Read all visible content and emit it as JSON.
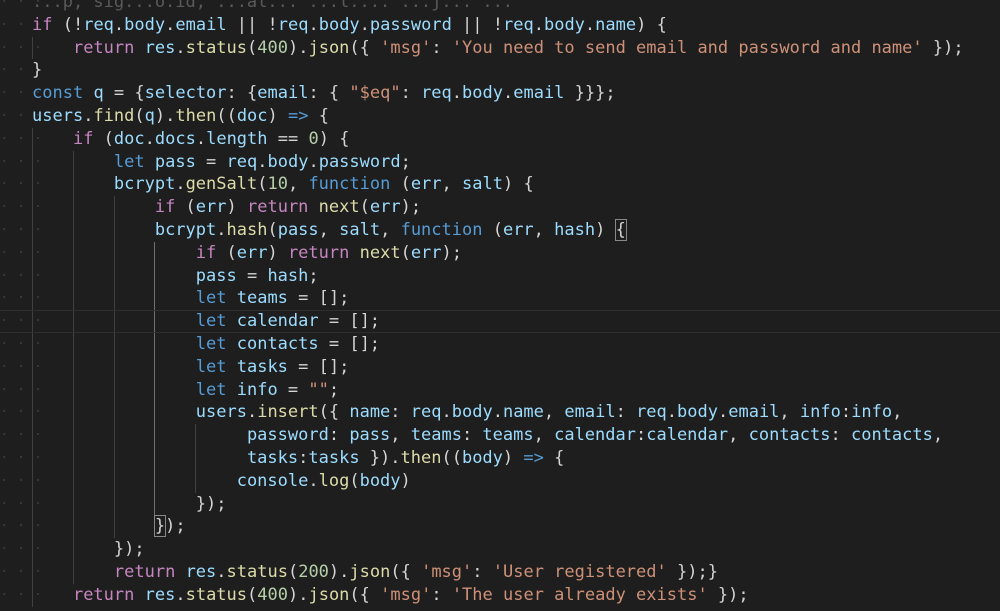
{
  "editor": {
    "indent_columns": 4,
    "lines": [
      {
        "indent": 0,
        "tokens": [
          {
            "t": "...p, sig...o.id, ...al... ...l.... ...j... ...",
            "c": "dim"
          }
        ]
      },
      {
        "indent": 0,
        "tokens": [
          {
            "t": "if",
            "c": "ctl"
          },
          {
            "t": " (!",
            "c": "pun"
          },
          {
            "t": "req",
            "c": "var"
          },
          {
            "t": ".",
            "c": "pun"
          },
          {
            "t": "body",
            "c": "var"
          },
          {
            "t": ".",
            "c": "pun"
          },
          {
            "t": "email",
            "c": "var"
          },
          {
            "t": " || !",
            "c": "pun"
          },
          {
            "t": "req",
            "c": "var"
          },
          {
            "t": ".",
            "c": "pun"
          },
          {
            "t": "body",
            "c": "var"
          },
          {
            "t": ".",
            "c": "pun"
          },
          {
            "t": "password",
            "c": "var"
          },
          {
            "t": " || !",
            "c": "pun"
          },
          {
            "t": "req",
            "c": "var"
          },
          {
            "t": ".",
            "c": "pun"
          },
          {
            "t": "body",
            "c": "var"
          },
          {
            "t": ".",
            "c": "pun"
          },
          {
            "t": "name",
            "c": "var"
          },
          {
            "t": ") {",
            "c": "pun"
          }
        ]
      },
      {
        "indent": 4,
        "tokens": [
          {
            "t": "return",
            "c": "ctl"
          },
          {
            "t": " ",
            "c": "pun"
          },
          {
            "t": "res",
            "c": "var"
          },
          {
            "t": ".",
            "c": "pun"
          },
          {
            "t": "status",
            "c": "fn"
          },
          {
            "t": "(",
            "c": "pun"
          },
          {
            "t": "400",
            "c": "num"
          },
          {
            "t": ").",
            "c": "pun"
          },
          {
            "t": "json",
            "c": "fn"
          },
          {
            "t": "({ ",
            "c": "pun"
          },
          {
            "t": "'msg'",
            "c": "str"
          },
          {
            "t": ": ",
            "c": "pun"
          },
          {
            "t": "'You need to send email and password and name'",
            "c": "str"
          },
          {
            "t": " });",
            "c": "pun"
          }
        ]
      },
      {
        "indent": 0,
        "tokens": [
          {
            "t": "}",
            "c": "pun"
          }
        ]
      },
      {
        "indent": 0,
        "tokens": [
          {
            "t": "const",
            "c": "kw"
          },
          {
            "t": " ",
            "c": "pun"
          },
          {
            "t": "q",
            "c": "var"
          },
          {
            "t": " = {",
            "c": "pun"
          },
          {
            "t": "selector",
            "c": "var"
          },
          {
            "t": ": {",
            "c": "pun"
          },
          {
            "t": "email",
            "c": "var"
          },
          {
            "t": ": { ",
            "c": "pun"
          },
          {
            "t": "\"$eq\"",
            "c": "str"
          },
          {
            "t": ": ",
            "c": "pun"
          },
          {
            "t": "req",
            "c": "var"
          },
          {
            "t": ".",
            "c": "pun"
          },
          {
            "t": "body",
            "c": "var"
          },
          {
            "t": ".",
            "c": "pun"
          },
          {
            "t": "email",
            "c": "var"
          },
          {
            "t": " }}};",
            "c": "pun"
          }
        ]
      },
      {
        "indent": 0,
        "tokens": [
          {
            "t": "users",
            "c": "var"
          },
          {
            "t": ".",
            "c": "pun"
          },
          {
            "t": "find",
            "c": "fn"
          },
          {
            "t": "(",
            "c": "pun"
          },
          {
            "t": "q",
            "c": "var"
          },
          {
            "t": ").",
            "c": "pun"
          },
          {
            "t": "then",
            "c": "fn"
          },
          {
            "t": "((",
            "c": "pun"
          },
          {
            "t": "doc",
            "c": "var"
          },
          {
            "t": ") ",
            "c": "pun"
          },
          {
            "t": "=>",
            "c": "kw"
          },
          {
            "t": " {",
            "c": "pun"
          }
        ]
      },
      {
        "indent": 4,
        "tokens": [
          {
            "t": "if",
            "c": "ctl"
          },
          {
            "t": " (",
            "c": "pun"
          },
          {
            "t": "doc",
            "c": "var"
          },
          {
            "t": ".",
            "c": "pun"
          },
          {
            "t": "docs",
            "c": "var"
          },
          {
            "t": ".",
            "c": "pun"
          },
          {
            "t": "length",
            "c": "var"
          },
          {
            "t": " == ",
            "c": "pun"
          },
          {
            "t": "0",
            "c": "num"
          },
          {
            "t": ") {",
            "c": "pun"
          }
        ]
      },
      {
        "indent": 8,
        "tokens": [
          {
            "t": "let",
            "c": "kw"
          },
          {
            "t": " ",
            "c": "pun"
          },
          {
            "t": "pass",
            "c": "var"
          },
          {
            "t": " = ",
            "c": "pun"
          },
          {
            "t": "req",
            "c": "var"
          },
          {
            "t": ".",
            "c": "pun"
          },
          {
            "t": "body",
            "c": "var"
          },
          {
            "t": ".",
            "c": "pun"
          },
          {
            "t": "password",
            "c": "var"
          },
          {
            "t": ";",
            "c": "pun"
          }
        ]
      },
      {
        "indent": 8,
        "tokens": [
          {
            "t": "bcrypt",
            "c": "var"
          },
          {
            "t": ".",
            "c": "pun"
          },
          {
            "t": "genSalt",
            "c": "fn"
          },
          {
            "t": "(",
            "c": "pun"
          },
          {
            "t": "10",
            "c": "num"
          },
          {
            "t": ", ",
            "c": "pun"
          },
          {
            "t": "function",
            "c": "kw"
          },
          {
            "t": " (",
            "c": "pun"
          },
          {
            "t": "err",
            "c": "var"
          },
          {
            "t": ", ",
            "c": "pun"
          },
          {
            "t": "salt",
            "c": "var"
          },
          {
            "t": ") {",
            "c": "pun"
          }
        ]
      },
      {
        "indent": 12,
        "tokens": [
          {
            "t": "if",
            "c": "ctl"
          },
          {
            "t": " (",
            "c": "pun"
          },
          {
            "t": "err",
            "c": "var"
          },
          {
            "t": ") ",
            "c": "pun"
          },
          {
            "t": "return",
            "c": "ctl"
          },
          {
            "t": " ",
            "c": "pun"
          },
          {
            "t": "next",
            "c": "fn"
          },
          {
            "t": "(",
            "c": "pun"
          },
          {
            "t": "err",
            "c": "var"
          },
          {
            "t": ");",
            "c": "pun"
          }
        ]
      },
      {
        "indent": 12,
        "tokens": [
          {
            "t": "bcrypt",
            "c": "var"
          },
          {
            "t": ".",
            "c": "pun"
          },
          {
            "t": "hash",
            "c": "fn"
          },
          {
            "t": "(",
            "c": "pun"
          },
          {
            "t": "pass",
            "c": "var"
          },
          {
            "t": ", ",
            "c": "pun"
          },
          {
            "t": "salt",
            "c": "var"
          },
          {
            "t": ", ",
            "c": "pun"
          },
          {
            "t": "function",
            "c": "kw"
          },
          {
            "t": " (",
            "c": "pun"
          },
          {
            "t": "err",
            "c": "var"
          },
          {
            "t": ", ",
            "c": "pun"
          },
          {
            "t": "hash",
            "c": "var"
          },
          {
            "t": ") ",
            "c": "pun"
          },
          {
            "t": "{",
            "c": "bm"
          }
        ]
      },
      {
        "indent": 16,
        "tokens": [
          {
            "t": "if",
            "c": "ctl"
          },
          {
            "t": " (",
            "c": "pun"
          },
          {
            "t": "err",
            "c": "var"
          },
          {
            "t": ") ",
            "c": "pun"
          },
          {
            "t": "return",
            "c": "ctl"
          },
          {
            "t": " ",
            "c": "pun"
          },
          {
            "t": "next",
            "c": "fn"
          },
          {
            "t": "(",
            "c": "pun"
          },
          {
            "t": "err",
            "c": "var"
          },
          {
            "t": ");",
            "c": "pun"
          }
        ]
      },
      {
        "indent": 16,
        "tokens": [
          {
            "t": "pass",
            "c": "var"
          },
          {
            "t": " = ",
            "c": "pun"
          },
          {
            "t": "hash",
            "c": "var"
          },
          {
            "t": ";",
            "c": "pun"
          }
        ]
      },
      {
        "indent": 16,
        "tokens": [
          {
            "t": "let",
            "c": "kw"
          },
          {
            "t": " ",
            "c": "pun"
          },
          {
            "t": "teams",
            "c": "var"
          },
          {
            "t": " = [];",
            "c": "pun"
          }
        ]
      },
      {
        "indent": 16,
        "current": true,
        "tokens": [
          {
            "t": "let",
            "c": "kw"
          },
          {
            "t": " ",
            "c": "pun"
          },
          {
            "t": "calendar",
            "c": "var"
          },
          {
            "t": " = [];",
            "c": "pun"
          }
        ]
      },
      {
        "indent": 16,
        "tokens": [
          {
            "t": "let",
            "c": "kw"
          },
          {
            "t": " ",
            "c": "pun"
          },
          {
            "t": "contacts",
            "c": "var"
          },
          {
            "t": " = [];",
            "c": "pun"
          }
        ]
      },
      {
        "indent": 16,
        "tokens": [
          {
            "t": "let",
            "c": "kw"
          },
          {
            "t": " ",
            "c": "pun"
          },
          {
            "t": "tasks",
            "c": "var"
          },
          {
            "t": " = [];",
            "c": "pun"
          }
        ]
      },
      {
        "indent": 16,
        "tokens": [
          {
            "t": "let",
            "c": "kw"
          },
          {
            "t": " ",
            "c": "pun"
          },
          {
            "t": "info",
            "c": "var"
          },
          {
            "t": " = ",
            "c": "pun"
          },
          {
            "t": "\"\"",
            "c": "str"
          },
          {
            "t": ";",
            "c": "pun"
          }
        ]
      },
      {
        "indent": 16,
        "tokens": [
          {
            "t": "users",
            "c": "var"
          },
          {
            "t": ".",
            "c": "pun"
          },
          {
            "t": "insert",
            "c": "fn"
          },
          {
            "t": "({ ",
            "c": "pun"
          },
          {
            "t": "name",
            "c": "var"
          },
          {
            "t": ": ",
            "c": "pun"
          },
          {
            "t": "req",
            "c": "var"
          },
          {
            "t": ".",
            "c": "pun"
          },
          {
            "t": "body",
            "c": "var"
          },
          {
            "t": ".",
            "c": "pun"
          },
          {
            "t": "name",
            "c": "var"
          },
          {
            "t": ", ",
            "c": "pun"
          },
          {
            "t": "email",
            "c": "var"
          },
          {
            "t": ": ",
            "c": "pun"
          },
          {
            "t": "req",
            "c": "var"
          },
          {
            "t": ".",
            "c": "pun"
          },
          {
            "t": "body",
            "c": "var"
          },
          {
            "t": ".",
            "c": "pun"
          },
          {
            "t": "email",
            "c": "var"
          },
          {
            "t": ", ",
            "c": "pun"
          },
          {
            "t": "info",
            "c": "var"
          },
          {
            "t": ":",
            "c": "pun"
          },
          {
            "t": "info",
            "c": "var"
          },
          {
            "t": ",",
            "c": "pun"
          }
        ]
      },
      {
        "indent": 21,
        "tokens": [
          {
            "t": "password",
            "c": "var"
          },
          {
            "t": ": ",
            "c": "pun"
          },
          {
            "t": "pass",
            "c": "var"
          },
          {
            "t": ", ",
            "c": "pun"
          },
          {
            "t": "teams",
            "c": "var"
          },
          {
            "t": ": ",
            "c": "pun"
          },
          {
            "t": "teams",
            "c": "var"
          },
          {
            "t": ", ",
            "c": "pun"
          },
          {
            "t": "calendar",
            "c": "var"
          },
          {
            "t": ":",
            "c": "pun"
          },
          {
            "t": "calendar",
            "c": "var"
          },
          {
            "t": ", ",
            "c": "pun"
          },
          {
            "t": "contacts",
            "c": "var"
          },
          {
            "t": ": ",
            "c": "pun"
          },
          {
            "t": "contacts",
            "c": "var"
          },
          {
            "t": ",",
            "c": "pun"
          }
        ]
      },
      {
        "indent": 21,
        "tokens": [
          {
            "t": "tasks",
            "c": "var"
          },
          {
            "t": ":",
            "c": "pun"
          },
          {
            "t": "tasks",
            "c": "var"
          },
          {
            "t": " }).",
            "c": "pun"
          },
          {
            "t": "then",
            "c": "fn"
          },
          {
            "t": "((",
            "c": "pun"
          },
          {
            "t": "body",
            "c": "var"
          },
          {
            "t": ") ",
            "c": "pun"
          },
          {
            "t": "=>",
            "c": "kw"
          },
          {
            "t": " {",
            "c": "pun"
          }
        ]
      },
      {
        "indent": 20,
        "tokens": [
          {
            "t": "console",
            "c": "var"
          },
          {
            "t": ".",
            "c": "pun"
          },
          {
            "t": "log",
            "c": "fn"
          },
          {
            "t": "(",
            "c": "pun"
          },
          {
            "t": "body",
            "c": "var"
          },
          {
            "t": ")",
            "c": "pun"
          }
        ]
      },
      {
        "indent": 16,
        "tokens": [
          {
            "t": "});",
            "c": "pun"
          }
        ]
      },
      {
        "indent": 12,
        "tokens": [
          {
            "t": "}",
            "c": "bm"
          },
          {
            "t": ");",
            "c": "pun"
          }
        ]
      },
      {
        "indent": 8,
        "tokens": [
          {
            "t": "});",
            "c": "pun"
          }
        ]
      },
      {
        "indent": 8,
        "tokens": [
          {
            "t": "return",
            "c": "ctl"
          },
          {
            "t": " ",
            "c": "pun"
          },
          {
            "t": "res",
            "c": "var"
          },
          {
            "t": ".",
            "c": "pun"
          },
          {
            "t": "status",
            "c": "fn"
          },
          {
            "t": "(",
            "c": "pun"
          },
          {
            "t": "200",
            "c": "num"
          },
          {
            "t": ").",
            "c": "pun"
          },
          {
            "t": "json",
            "c": "fn"
          },
          {
            "t": "({ ",
            "c": "pun"
          },
          {
            "t": "'msg'",
            "c": "str"
          },
          {
            "t": ": ",
            "c": "pun"
          },
          {
            "t": "'User registered'",
            "c": "str"
          },
          {
            "t": " });}",
            "c": "pun"
          }
        ]
      },
      {
        "indent": 4,
        "tokens": [
          {
            "t": "return",
            "c": "ctl"
          },
          {
            "t": " ",
            "c": "pun"
          },
          {
            "t": "res",
            "c": "var"
          },
          {
            "t": ".",
            "c": "pun"
          },
          {
            "t": "status",
            "c": "fn"
          },
          {
            "t": "(",
            "c": "pun"
          },
          {
            "t": "400",
            "c": "num"
          },
          {
            "t": ").",
            "c": "pun"
          },
          {
            "t": "json",
            "c": "fn"
          },
          {
            "t": "({ ",
            "c": "pun"
          },
          {
            "t": "'msg'",
            "c": "str"
          },
          {
            "t": ": ",
            "c": "pun"
          },
          {
            "t": "'The user already exists'",
            "c": "str"
          },
          {
            "t": " });",
            "c": "pun"
          }
        ]
      }
    ]
  },
  "theme": {
    "background": "#1e1e1e",
    "keyword": "#569cd6",
    "control": "#c586c0",
    "variable": "#9cdcfe",
    "function": "#dcdcaa",
    "string": "#ce9178",
    "number": "#b5cea8",
    "punctuation": "#d4d4d4"
  }
}
